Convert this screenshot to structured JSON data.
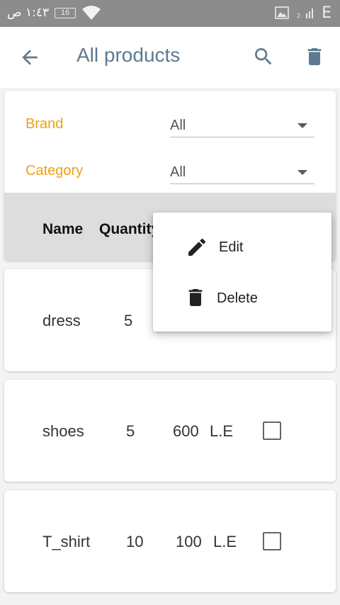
{
  "status_bar": {
    "time": "١:٤٣ ص",
    "battery": "16",
    "network": "E"
  },
  "app_bar": {
    "title": "All products",
    "back_icon": "arrow-back-icon",
    "search_icon": "search-icon",
    "delete_icon": "trash-icon"
  },
  "filters": {
    "brand": {
      "label": "Brand",
      "value": "All"
    },
    "category": {
      "label": "Category",
      "value": "All"
    }
  },
  "table": {
    "headers": [
      "Name",
      "Quantity"
    ],
    "rows": [
      {
        "name": "dress",
        "quantity": "5",
        "price": "",
        "currency": ""
      },
      {
        "name": "shoes",
        "quantity": "5",
        "price": "600",
        "currency": "L.E"
      },
      {
        "name": "T_shirt",
        "quantity": "10",
        "price": "100",
        "currency": "L.E"
      }
    ]
  },
  "context_menu": {
    "items": [
      {
        "label": "Edit",
        "icon": "pencil-icon"
      },
      {
        "label": "Delete",
        "icon": "trash-icon"
      }
    ]
  },
  "colors": {
    "accent": "#f0a014",
    "title": "#5c7a91",
    "header_bg": "#dddddd"
  }
}
